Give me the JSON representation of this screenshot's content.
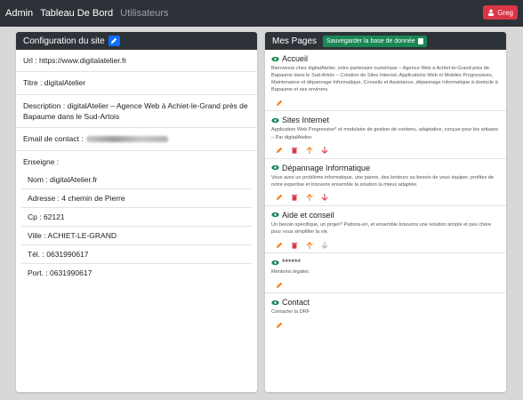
{
  "navbar": {
    "brand": "Admin",
    "links": [
      "Tableau De Bord",
      "Utilisateurs"
    ],
    "user": "Greg"
  },
  "config": {
    "title": "Configuration du site",
    "url": "Url : https://www.digitalatelier.fr",
    "titre": "Titre : digitalAtelier",
    "description": "Description : digitalAtelier – Agence Web à Achiet-le-Grand près de Bapaume dans le Sud-Artois",
    "email_label": "Email de contact :",
    "enseigne_label": "Enseigne :",
    "enseigne": [
      "Nom : digitalAtelier.fr",
      "Adresse : 4 chemin de Pierre",
      "Cp : 62121",
      "Ville : ACHIET-LE-GRAND",
      "Tél. : 0631990617",
      "Port. : 0631990617"
    ]
  },
  "pages": {
    "title": "Mes Pages",
    "save_label": "Sauvegarder la base de donnée",
    "items": [
      {
        "title": "Accueil",
        "desc": "Bienvenue chez digitalAtelier, votre partenaire numérique – Agence Web à Achiet-le-Grand près de Bapaume dans le Sud-Artois – Création de Sites Internet, Applications Web et Mobiles Progressives, Maintenance et dépannage Informatique, Conseils et Assistance, dépannage Informatique à domicile à Bapaume et ses environs."
      },
      {
        "title": "Sites Internet",
        "desc": "Application Web Progressive* et modulaire de gestion de contenu, adaptative, conçue pour les artisans – Par digitalAtelier."
      },
      {
        "title": "Dépannage Informatique",
        "desc": "Vous avez un problème informatique, une panne, des lenteurs ou besoin de vous équiper, profitez de notre expertise et trouvons ensemble la solution la mieux adaptée."
      },
      {
        "title": "Aide et conseil",
        "desc": "Un besoin spécifique, un projet? Parlons-en, et ensemble trouvons une solution simple et peu chère pour vous simplifier la vie."
      },
      {
        "title": "******",
        "desc": "Mentions légales"
      },
      {
        "title": "Contact",
        "desc": "Contacter la DRF"
      }
    ]
  },
  "colors": {
    "navbar": "#2d3238",
    "danger": "#dc3545",
    "primary": "#0d6efd",
    "success": "#198754",
    "eye": "#198754",
    "edit": "#fd7e14"
  },
  "icons": [
    "user-icon",
    "pencil-icon",
    "database-icon",
    "eye-icon",
    "trash-icon",
    "arrow-up-icon",
    "arrow-down-icon"
  ]
}
